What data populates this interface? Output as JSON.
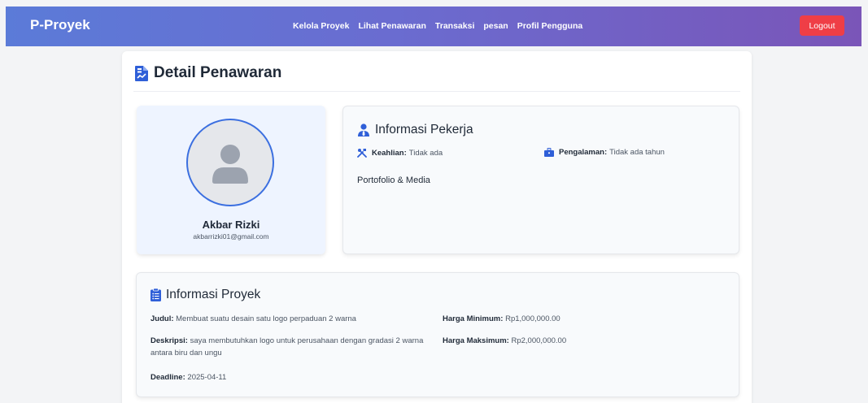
{
  "navbar": {
    "brand": "P-Proyek",
    "links": [
      "Kelola Proyek",
      "Lihat Penawaran",
      "Transaksi",
      "pesan",
      "Profil Pengguna"
    ],
    "logout_label": "Logout"
  },
  "page": {
    "title": "Detail Penawaran"
  },
  "profile": {
    "name": "Akbar Rizki",
    "email": "akbarrizki01@gmail.com"
  },
  "worker": {
    "title": "Informasi Pekerja",
    "skills_label": "Keahlian:",
    "skills_value": "Tidak ada",
    "experience_label": "Pengalaman:",
    "experience_value": "Tidak ada tahun",
    "portfolio_label": "Portofolio & Media"
  },
  "project": {
    "title": "Informasi Proyek",
    "judul_label": "Judul:",
    "judul_value": "Membuat suatu desain satu logo perpaduan 2 warna",
    "deskripsi_label": "Deskripsi:",
    "deskripsi_value": "saya membutuhkan logo untuk perusahaan dengan gradasi 2 warna antara biru dan ungu",
    "deadline_label": "Deadline:",
    "deadline_value": "2025-04-11",
    "harga_min_label": "Harga Minimum:",
    "harga_min_value": "Rp1,000,000.00",
    "harga_max_label": "Harga Maksimum:",
    "harga_max_value": "Rp2,000,000.00"
  },
  "colors": {
    "nav_gradient_start": "#5b7bd8",
    "nav_gradient_end": "#7a55b8",
    "logout": "#ef3e46",
    "accent": "#3b6fe0",
    "icon_blue": "#2f5fd8"
  },
  "icons": {
    "title": "document-chart-icon",
    "worker": "user-tie-icon",
    "skills": "tools-icon",
    "experience": "briefcase-icon",
    "project": "clipboard-list-icon",
    "avatar": "user-silhouette-icon"
  }
}
